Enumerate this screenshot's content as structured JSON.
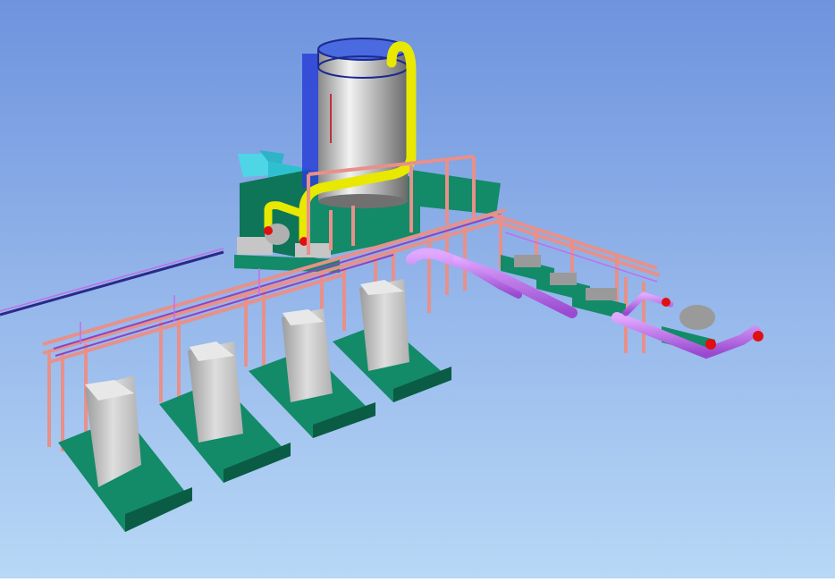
{
  "viewport": {
    "background_top": "#6f93de",
    "background_bottom": "#b8d8f6"
  },
  "colors": {
    "tank_light": "#e6e6e6",
    "tank_dark": "#7a7a7a",
    "tank_blue": "#2a3fd6",
    "hot_pipe": "#e8e800",
    "pipe_purple": "#c070e8",
    "pipe_purple_dark": "#8e44c0",
    "pipe_rack": "#e8908a",
    "pipe_rack_dark": "#b05a55",
    "skid_green": "#138a68",
    "skid_green_dark": "#0b5c45",
    "cabinet_light": "#d8d8d8",
    "cabinet_dark": "#a6a6a6",
    "flange_red": "#e01010",
    "cyan_hood": "#4ed6e6",
    "navy_pipe": "#2a2a8a"
  },
  "objects": [
    "storage-tank",
    "yellow-hot-pipe",
    "pipe-rack",
    "pump-skids",
    "electrical-cabinets",
    "cooling-hood",
    "long-process-pipe"
  ]
}
